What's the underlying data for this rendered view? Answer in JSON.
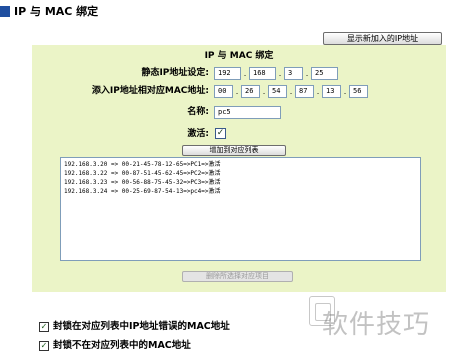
{
  "header": {
    "title": "IP 与 MAC 绑定"
  },
  "top_button": {
    "label": "显示新加入的IP地址"
  },
  "panel": {
    "title": "IP 与 MAC 绑定",
    "static_ip_label": "静态IP地址设定:",
    "ip": [
      "192",
      "168",
      "3",
      "25"
    ],
    "mac_label": "添入IP地址相对应MAC地址:",
    "mac": [
      "00",
      "26",
      "54",
      "87",
      "13",
      "56"
    ],
    "name_label": "名称:",
    "name_value": "pc5",
    "activate_label": "激活:",
    "activate_checked": true,
    "add_button": "增加到对应列表",
    "list": [
      "192.168.3.20 => 00-21-45-78-12-65=>PC1=>激活",
      "192.168.3.22 => 00-87-51-45-62-45=>PC2=>激活",
      "192.168.3.23 => 00-56-88-75-45-32=>PC3=>激活",
      "192.168.3.24 => 00-25-69-87-54-13=>pc4=>激活"
    ],
    "delete_button": "删除所选择对应项目"
  },
  "options": [
    {
      "label": "封锁在对应列表中IP地址错误的MAC地址",
      "checked": true
    },
    {
      "label": "封锁不在对应列表中的MAC地址",
      "checked": true
    }
  ],
  "watermark": {
    "text": "软件技巧"
  }
}
